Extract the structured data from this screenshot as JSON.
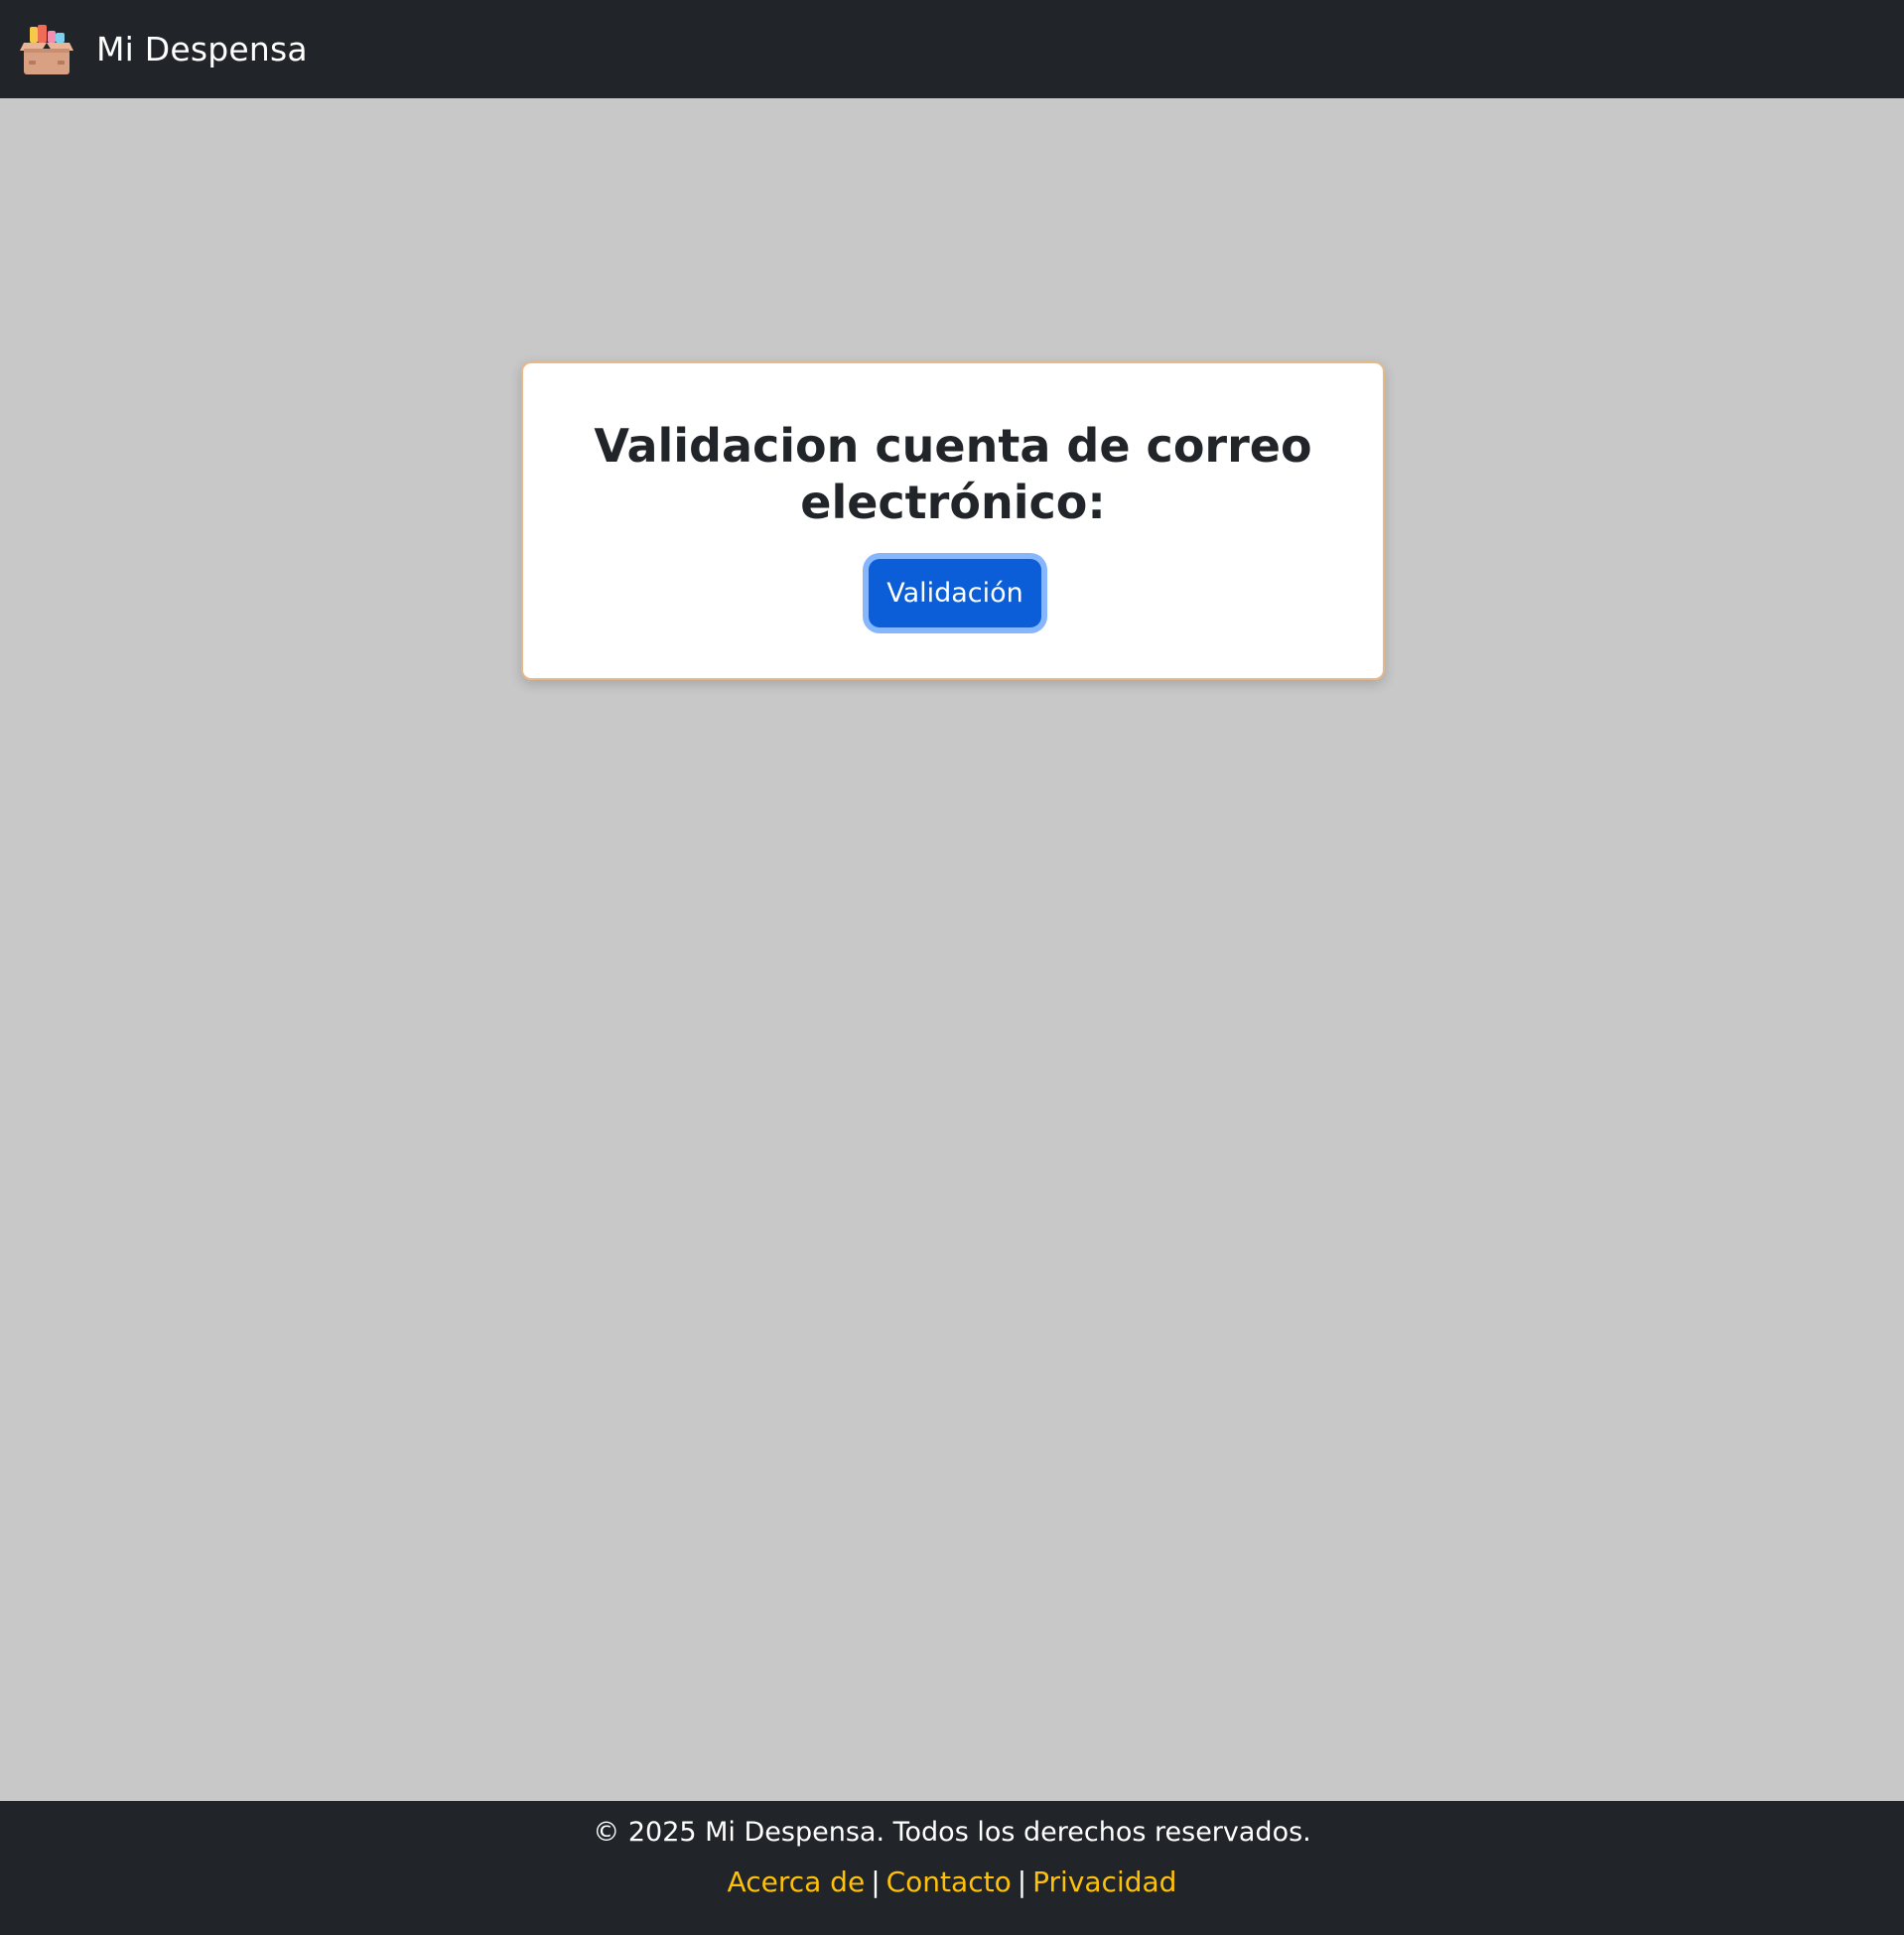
{
  "navbar": {
    "brand": "Mi Despensa",
    "logo_icon": "pantry-box-icon"
  },
  "card": {
    "title": "Validacion cuenta de correo electrónico:",
    "button_label": "Validación"
  },
  "footer": {
    "copyright": "© 2025 Mi Despensa. Todos los derechos reservados.",
    "links": [
      "Acerca de",
      "Contacto",
      "Privacidad"
    ],
    "separator": "|"
  },
  "colors": {
    "navbar_bg": "#212529",
    "page_bg": "#c8c8c8",
    "card_border": "#e6b98b",
    "button_bg": "#0b5ed7",
    "button_focus_ring": "#86b7fe",
    "link": "#ffc107"
  }
}
